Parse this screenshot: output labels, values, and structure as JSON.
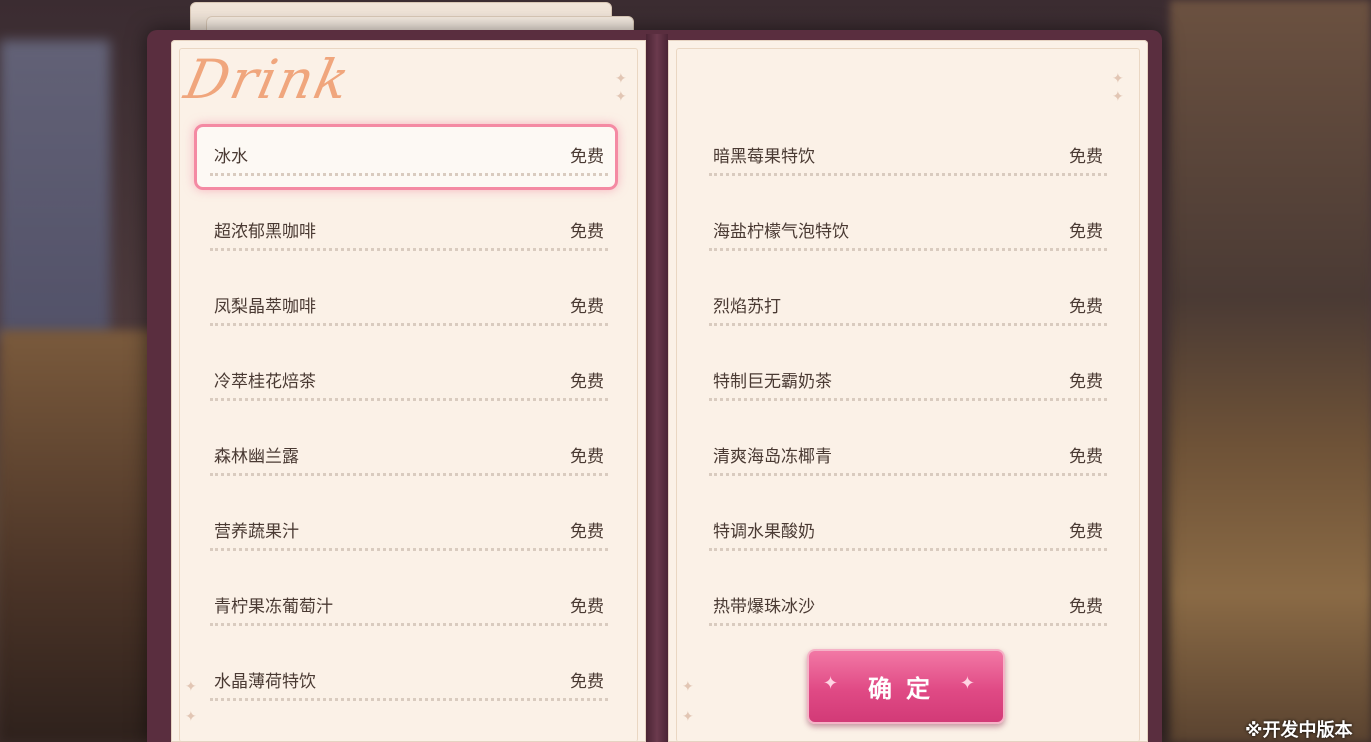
{
  "menu": {
    "title": "Drink",
    "left_items": [
      {
        "name": "冰水",
        "price": "免费",
        "selected": true
      },
      {
        "name": "超浓郁黑咖啡",
        "price": "免费"
      },
      {
        "name": "凤梨晶萃咖啡",
        "price": "免费"
      },
      {
        "name": "冷萃桂花焙茶",
        "price": "免费"
      },
      {
        "name": "森林幽兰露",
        "price": "免费"
      },
      {
        "name": "营养蔬果汁",
        "price": "免费"
      },
      {
        "name": "青柠果冻葡萄汁",
        "price": "免费"
      },
      {
        "name": "水晶薄荷特饮",
        "price": "免费"
      }
    ],
    "right_items": [
      {
        "name": "暗黑莓果特饮",
        "price": "免费"
      },
      {
        "name": "海盐柠檬气泡特饮",
        "price": "免费"
      },
      {
        "name": "烈焰苏打",
        "price": "免费"
      },
      {
        "name": "特制巨无霸奶茶",
        "price": "免费"
      },
      {
        "name": "清爽海岛冻椰青",
        "price": "免费"
      },
      {
        "name": "特调水果酸奶",
        "price": "免费"
      },
      {
        "name": "热带爆珠冰沙",
        "price": "免费"
      }
    ],
    "confirm_label": "确定"
  },
  "footer": {
    "dev_note": "※开发中版本"
  },
  "colors": {
    "accent": "#e04a85",
    "selected_border": "#f48aa3",
    "book_cover": "#5a2e3f",
    "paper": "#fbf1e7"
  }
}
